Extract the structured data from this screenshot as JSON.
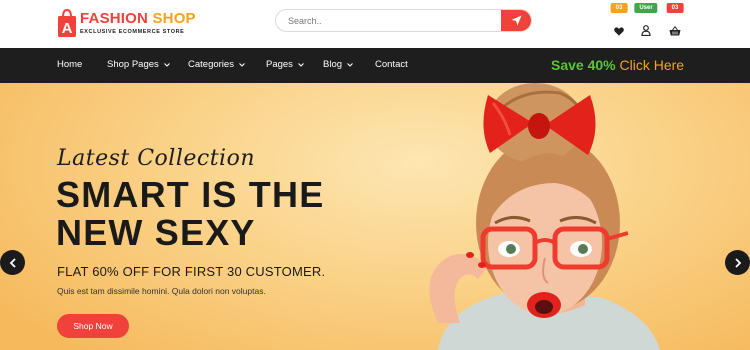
{
  "brand": {
    "name_part1": "FASHION",
    "name_part2": "SHOP",
    "tagline": "EXCLUSIVE ECOMMERCE STORE",
    "logo_letter": "A"
  },
  "search": {
    "placeholder": "Search..",
    "value": ""
  },
  "header_icons": [
    {
      "name": "wishlist",
      "icon": "heart-icon",
      "badge": "03",
      "badge_color": "#f5a31a"
    },
    {
      "name": "user",
      "icon": "user-icon",
      "badge": "User",
      "badge_color": "#3da845"
    },
    {
      "name": "cart",
      "icon": "basket-icon",
      "badge": "03",
      "badge_color": "#f0413a"
    }
  ],
  "nav": {
    "items": [
      {
        "label": "Home",
        "dropdown": false
      },
      {
        "label": "Shop Pages",
        "dropdown": true
      },
      {
        "label": "Categories",
        "dropdown": true
      },
      {
        "label": "Pages",
        "dropdown": true
      },
      {
        "label": "Blog",
        "dropdown": true
      },
      {
        "label": "Contact",
        "dropdown": false
      }
    ],
    "promo_highlight": "Save 40%",
    "promo_text": "Click Here"
  },
  "hero": {
    "script_title": "Latest Collection",
    "headline_line1": "SMART IS THE",
    "headline_line2": "NEW SEXY",
    "subheadline": "FLAT 60% OFF FOR FIRST 30 CUSTOMER.",
    "description": "Quis est tam dissimile homini. Qula dolori non voluptas.",
    "cta_label": "Shop Now"
  },
  "colors": {
    "accent_red": "#f0413a",
    "accent_orange": "#f5a31a",
    "accent_green": "#3da845",
    "nav_bg": "#1e1e1e",
    "promo_green": "#5cc43a"
  }
}
